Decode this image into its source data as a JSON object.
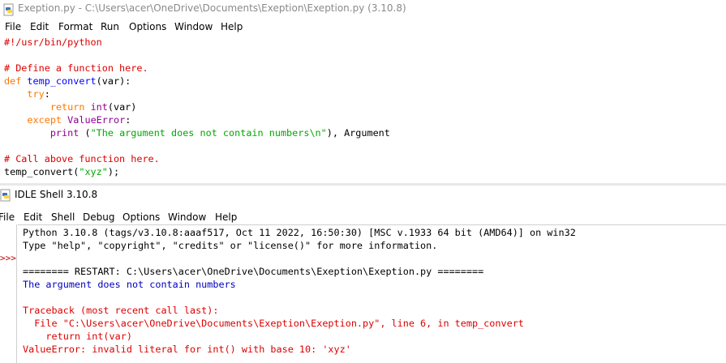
{
  "editor": {
    "title": "Exeption.py - C:\\Users\\acer\\OneDrive\\Documents\\Exeption\\Exeption.py (3.10.8)",
    "menu": [
      "File",
      "Edit",
      "Format",
      "Run",
      "Options",
      "Window",
      "Help"
    ],
    "code": {
      "l1": "#!/usr/bin/python",
      "l3": "# Define a function here.",
      "l4_kw": "def",
      "l4_fn": "temp_convert",
      "l4_rest": "(var):",
      "l5_kw": "try",
      "l5_rest": ":",
      "l6_kw": "return",
      "l6_bi": "int",
      "l6_rest": "(var)",
      "l7_kw": "except",
      "l7_bi": "ValueError",
      "l7_rest": ":",
      "l8_bi": "print",
      "l8_pre": " (",
      "l8_str": "\"The argument does not contain numbers\\n\"",
      "l8_rest": "), Argument",
      "l10": "# Call above function here.",
      "l11_pre": "temp_convert(",
      "l11_str": "\"xyz\"",
      "l11_rest": ");"
    }
  },
  "shell": {
    "title": "IDLE Shell 3.10.8",
    "menu": [
      "File",
      "Edit",
      "Shell",
      "Debug",
      "Options",
      "Window",
      "Help"
    ],
    "prompt": ">>>",
    "lines": {
      "version": "Python 3.10.8 (tags/v3.10.8:aaaf517, Oct 11 2022, 16:50:30) [MSC v.1933 64 bit (AMD64)] on win32",
      "help": "Type \"help\", \"copyright\", \"credits\" or \"license()\" for more information.",
      "restart": "======== RESTART: C:\\Users\\acer\\OneDrive\\Documents\\Exeption\\Exeption.py ========",
      "output": "The argument does not contain numbers",
      "tb1": "Traceback (most recent call last):",
      "tb2": "  File \"C:\\Users\\acer\\OneDrive\\Documents\\Exeption\\Exeption.py\", line 6, in temp_convert",
      "tb3": "    return int(var)",
      "tb4": "ValueError: invalid literal for int() with base 10: 'xyz'"
    }
  },
  "colors": {
    "keyword": "#ff7700",
    "function": "#0000ff",
    "string": "#00aa00",
    "comment": "#dd0000",
    "builtin": "#900090",
    "stdout": "#0000c0",
    "stderr": "#dd0000"
  },
  "icons": {
    "editor": "python-file-icon",
    "shell": "python-shell-icon"
  }
}
